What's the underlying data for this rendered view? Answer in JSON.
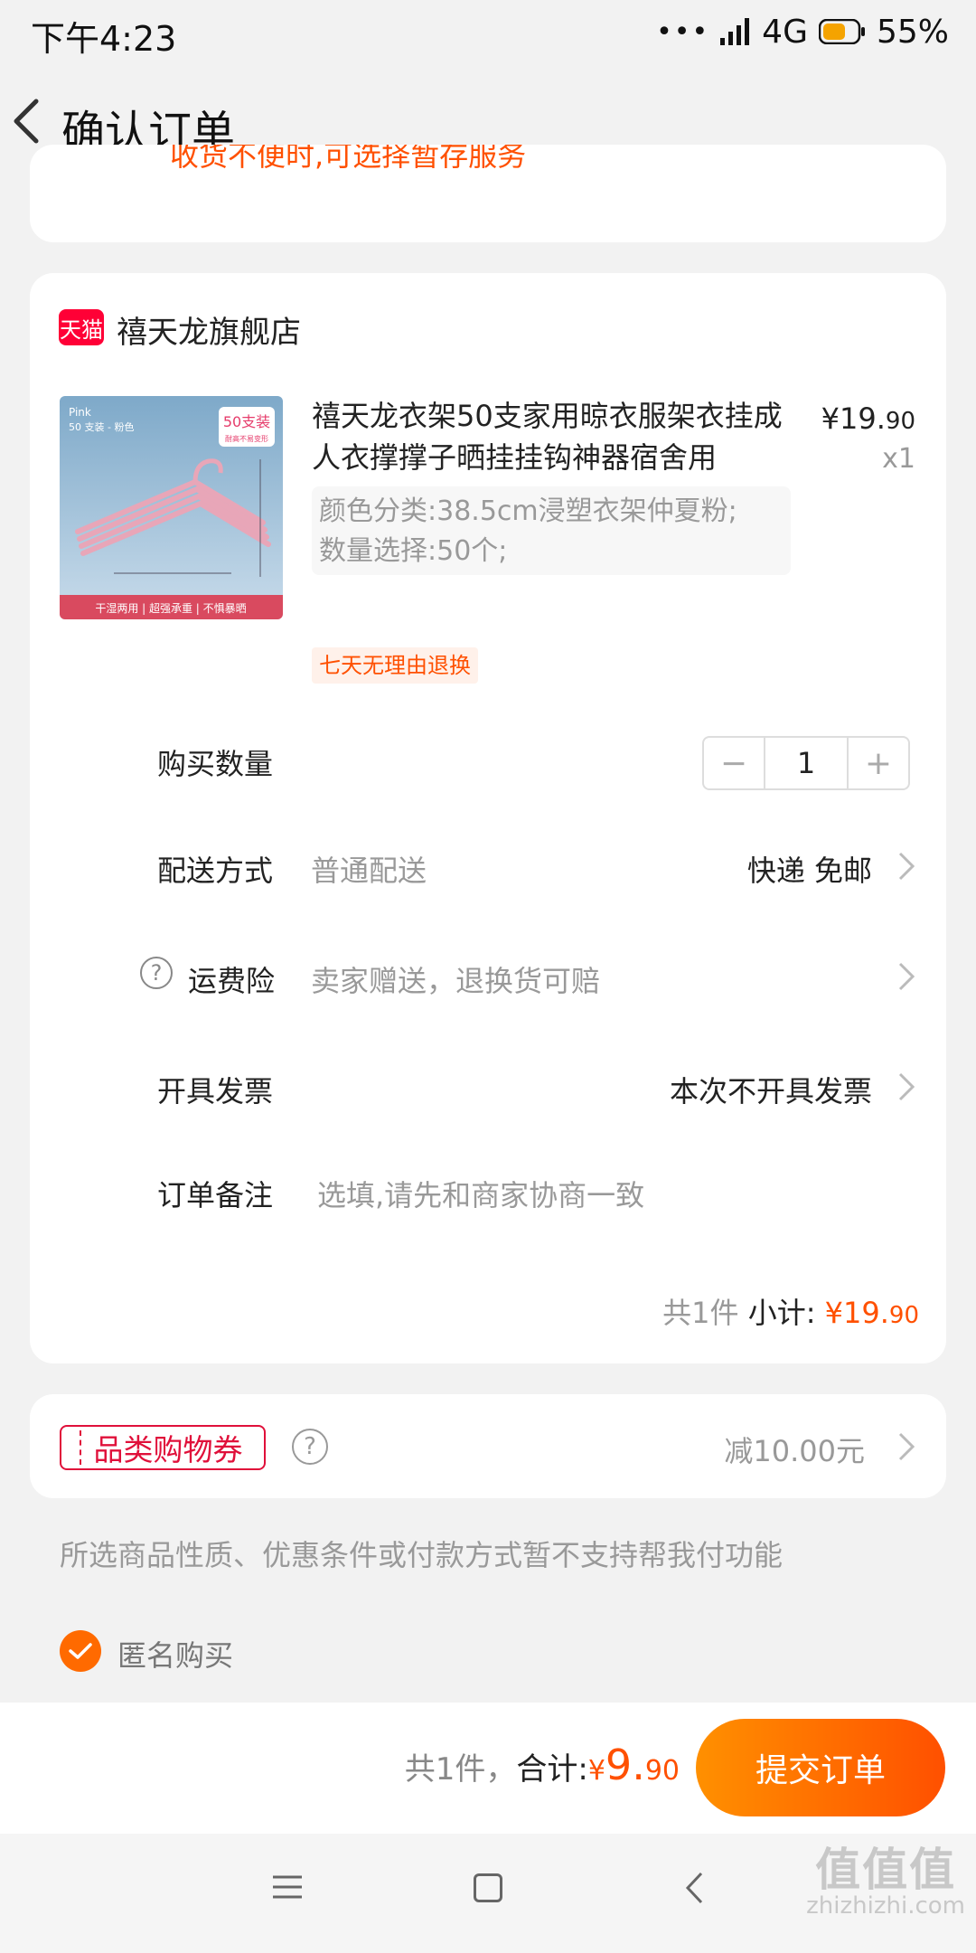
{
  "status": {
    "time": "下午4:23",
    "network": "4G",
    "battery": "55%"
  },
  "nav": {
    "title": "确认订单"
  },
  "top_notice": "收货不便时,可选择暂存服务",
  "shop": {
    "badge": "天猫",
    "name": "禧天龙旗舰店"
  },
  "product": {
    "title": "禧天龙衣架50支家用晾衣服架衣挂成人衣撑撑子晒挂挂钩神器宿舍用",
    "price_main": "¥19.",
    "price_decimal": "90",
    "quantity": "x1",
    "sku_line1": "颜色分类:38.5cm浸塑衣架仲夏粉;",
    "sku_line2": "数量选择:50个;",
    "return_tag": "七天无理由退换",
    "image": {
      "label_en": "Pink",
      "label_cn": "50 支装 - 粉色",
      "badge_top": "50支装",
      "badge_sub": "耐高不易变形",
      "footer": "干湿两用 | 超强承重 | 不惧暴晒"
    }
  },
  "rows": {
    "quantity_label": "购买数量",
    "quantity_value": "1",
    "minus": "−",
    "plus": "+",
    "delivery_label": "配送方式",
    "delivery_sub": "普通配送",
    "delivery_value": "快递 免邮",
    "insurance_icon": "?",
    "insurance_label": "运费险",
    "insurance_sub": "卖家赠送，退换货可赔",
    "invoice_label": "开具发票",
    "invoice_value": "本次不开具发票",
    "remark_label": "订单备注",
    "remark_placeholder": "选填,请先和商家协商一致"
  },
  "subtotal": {
    "count": "共1件",
    "label": " 小计: ",
    "price_main": "¥19.",
    "price_decimal": "90"
  },
  "coupon": {
    "label": "品类购物券",
    "help": "?",
    "value": "减10.00元"
  },
  "pay_note": "所选商品性质、优惠条件或付款方式暂不支持帮我付功能",
  "anonymous": {
    "label": "匿名购买",
    "checked": true
  },
  "footer": {
    "count": "共1件，",
    "total_label": "合计:",
    "currency": "¥",
    "total_main": "9.",
    "total_decimal": "90",
    "submit": "提交订单"
  },
  "watermark": {
    "line1": "值值值",
    "line2": "zhizhizhi.com"
  },
  "colors": {
    "accent": "#ff5000",
    "tmall": "#ff0036",
    "coupon": "#e0103a"
  }
}
